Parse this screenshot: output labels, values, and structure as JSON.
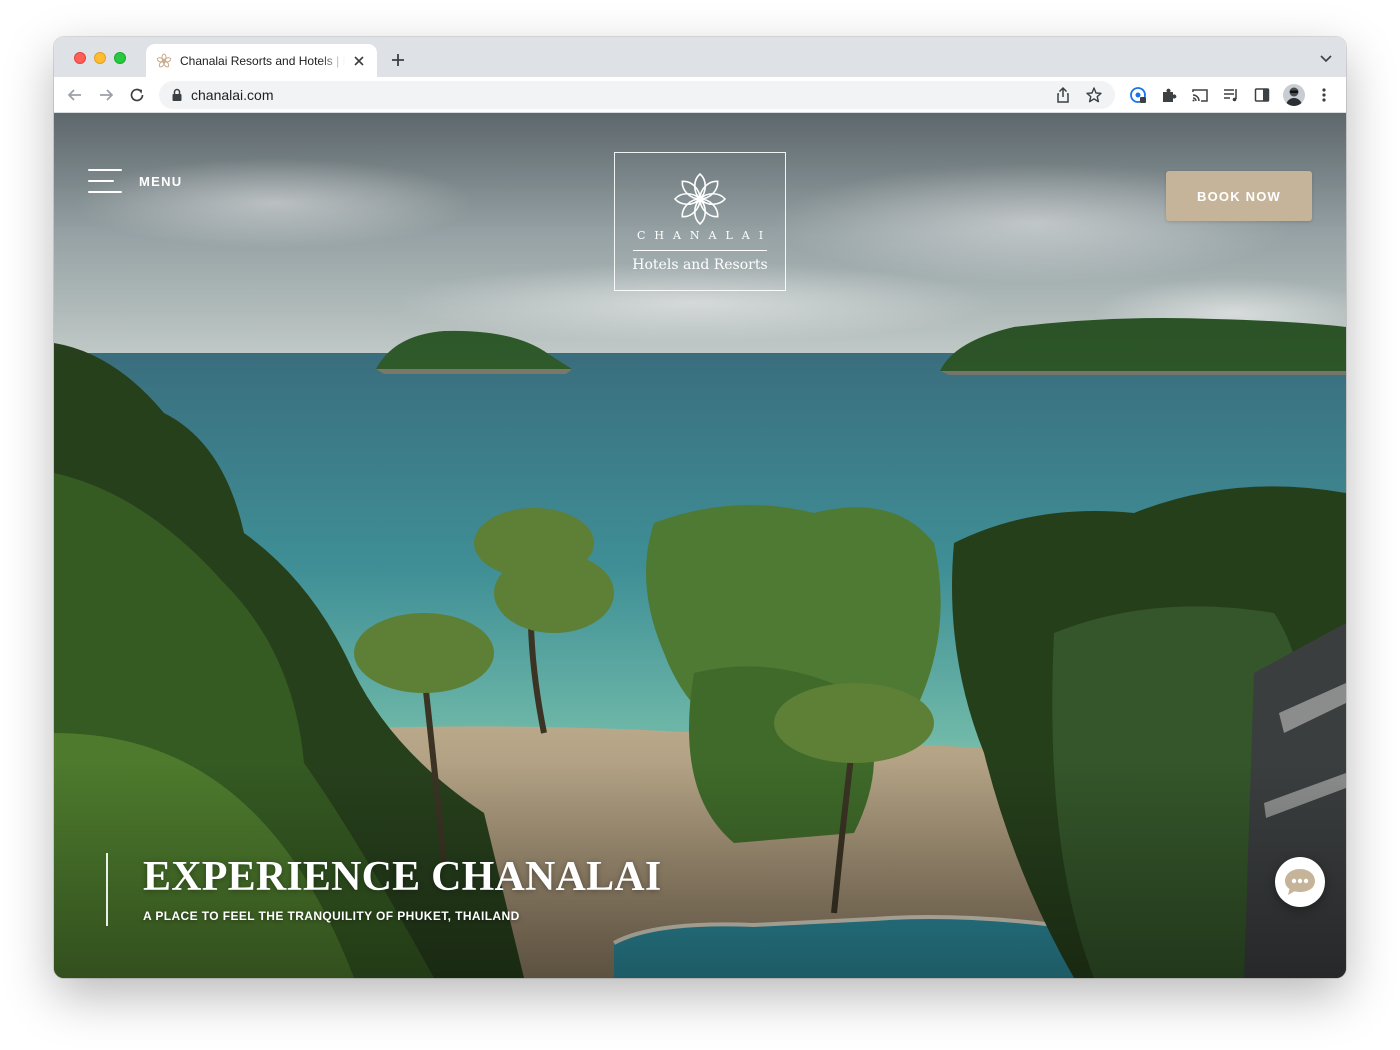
{
  "browser": {
    "tab_title": "Chanalai Resorts and Hotels | Phuket",
    "url": "chanalai.com"
  },
  "site": {
    "menu_label": "MENU",
    "logo": {
      "name": "CHANALAI",
      "subtitle": "Hotels and Resorts"
    },
    "book_button": "BOOK NOW",
    "hero": {
      "title": "EXPERIENCE CHANALAI",
      "subtitle": "A PLACE TO FEEL THE TRANQUILITY OF PHUKET, THAILAND"
    }
  },
  "colors": {
    "accent": "#c6b49a",
    "tabstrip": "#dee1e6",
    "sea": "#3f8f96",
    "foliage": "#3b5a25"
  }
}
